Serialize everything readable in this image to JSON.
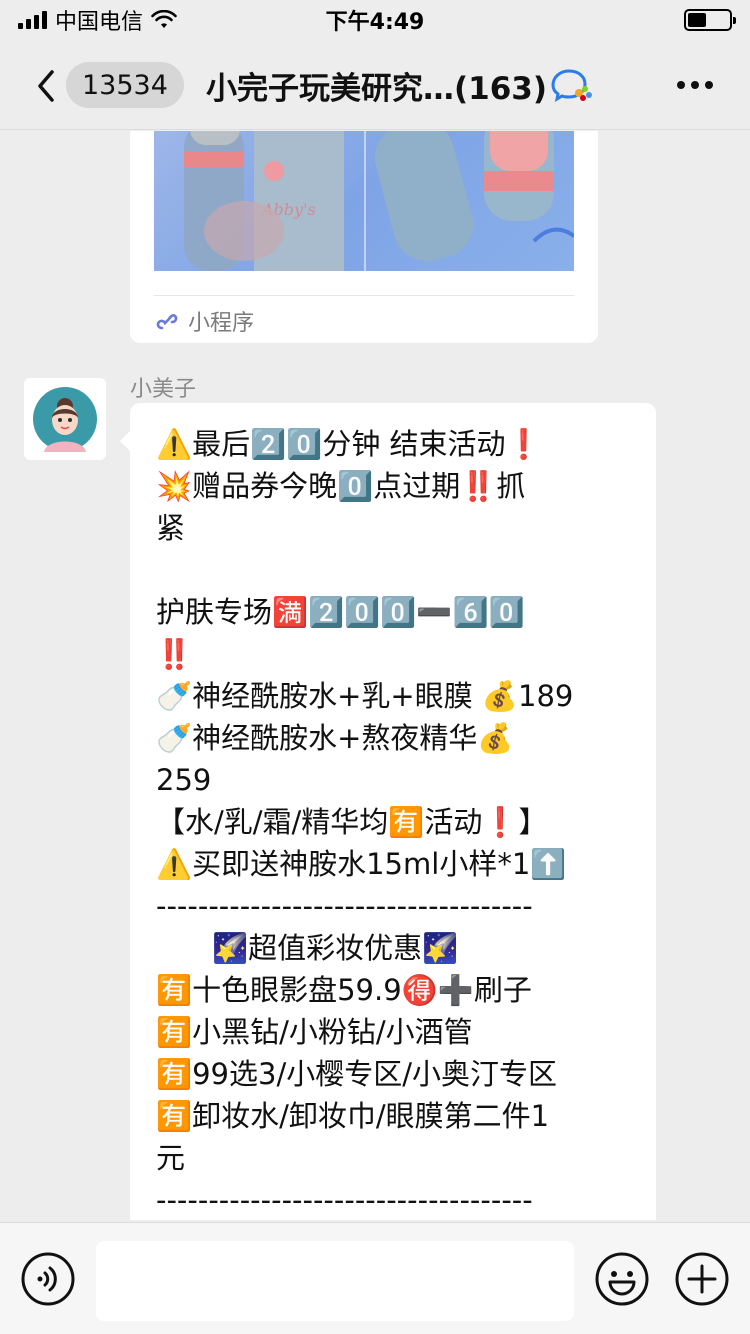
{
  "status_bar": {
    "carrier": "中国电信",
    "time": "下午4:49",
    "battery_level": 0.45
  },
  "nav": {
    "back_badge": "13534",
    "title": "小完子玩美研究…(163)"
  },
  "mini_program": {
    "label": "小程序",
    "image_text": "Abby's"
  },
  "message": {
    "sender": "小美子",
    "lines": [
      "⚠️最后2️⃣0️⃣分钟 结束活动❗️",
      "💥赠品券今晚0️⃣点过期‼️抓",
      "紧",
      "",
      "护肤专场🈵2️⃣0️⃣0️⃣➖6️⃣0️⃣",
      "‼️",
      "🍼神经酰胺水+乳+眼膜 💰189",
      "🍼神经酰胺水+熬夜精华💰",
      "259",
      "【水/乳/霜/精华均🈶活动❗️】",
      "⚠️买即送神胺水15ml小样*1⬆️",
      "------------------------------------",
      "🌠超值彩妆优惠🌠",
      "🈶十色眼影盘59.9🉐➕刷子",
      "🈶小黑钻/小粉钻/小酒管",
      "🈶99选3/小樱专区/小奥汀专区",
      "🈶卸妆水/卸妆巾/眼膜第二件1",
      "元",
      "------------------------------------"
    ]
  },
  "input_bar": {
    "placeholder": ""
  }
}
